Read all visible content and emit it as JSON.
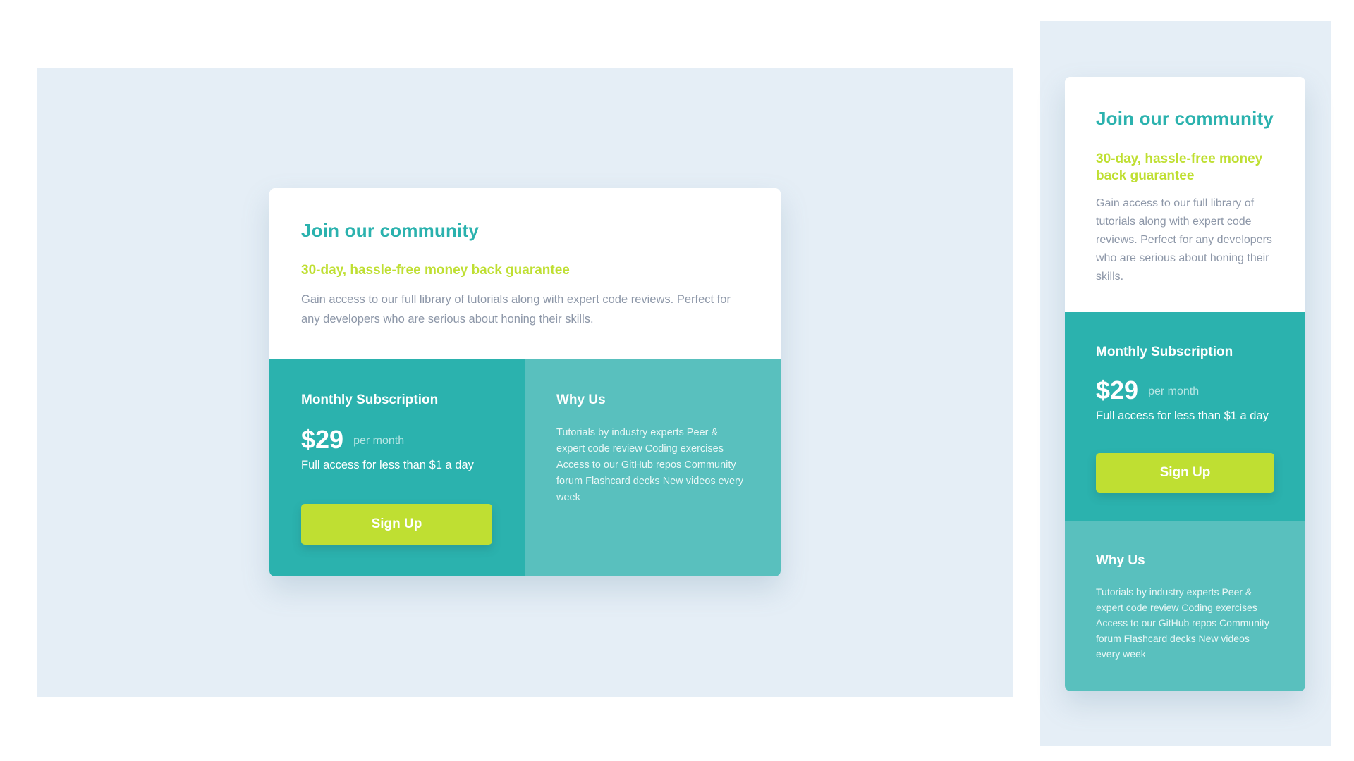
{
  "card": {
    "title": "Join our community",
    "subtitle": "30-day, hassle-free money back guarantee",
    "description": "Gain access to our full library of tutorials along with expert code reviews. Perfect for any developers who are serious about honing their skills.",
    "subscription": {
      "heading": "Monthly Subscription",
      "price": "$29",
      "period": "per month",
      "note": "Full access for less than $1 a day",
      "button_label": "Sign Up"
    },
    "why_us": {
      "heading": "Why Us",
      "text": "Tutorials by industry experts Peer & expert code review Coding exercises Access to our GitHub repos Community forum Flashcard decks New videos every week"
    }
  },
  "colors": {
    "panel_bg": "#e5eef6",
    "primary_teal": "#2bb2ae",
    "light_teal": "#59c0be",
    "lime": "#bfdf32",
    "text_gray": "#8d97a8"
  }
}
